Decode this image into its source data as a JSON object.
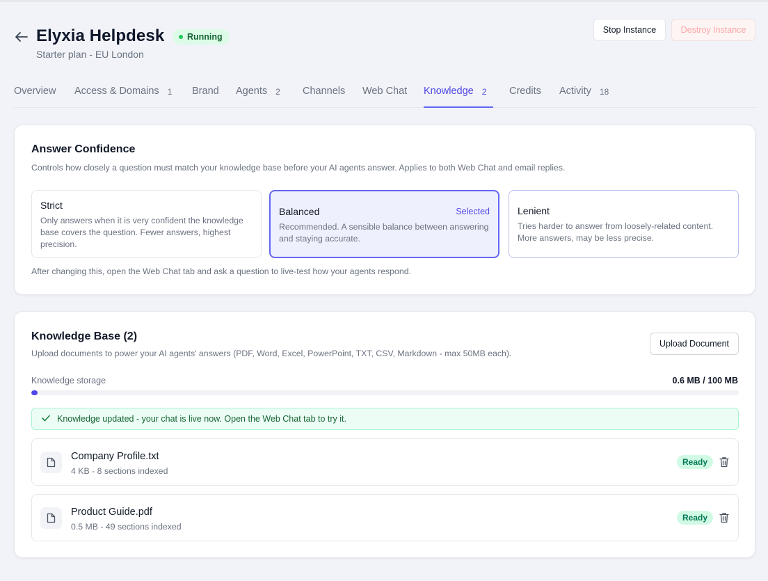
{
  "header": {
    "title": "Elyxia Helpdesk",
    "status": "Running",
    "subtitle": "Starter plan - EU London",
    "stop_label": "Stop Instance",
    "destroy_label": "Destroy Instance"
  },
  "tabs": [
    {
      "label": "Overview",
      "count": ""
    },
    {
      "label": "Access & Domains",
      "count": "1"
    },
    {
      "label": "Brand",
      "count": ""
    },
    {
      "label": "Agents",
      "count": "2"
    },
    {
      "label": "Channels",
      "count": ""
    },
    {
      "label": "Web Chat",
      "count": ""
    },
    {
      "label": "Knowledge",
      "count": "2"
    },
    {
      "label": "Credits",
      "count": ""
    },
    {
      "label": "Activity",
      "count": "18"
    }
  ],
  "active_tab": "Knowledge",
  "confidence": {
    "title": "Answer Confidence",
    "description": "Controls how closely a question must match your knowledge base before your AI agents answer. Applies to both Web Chat and email replies.",
    "options": [
      {
        "name": "Strict",
        "text": "Only answers when it is very confident the knowledge base covers the question. Fewer answers, highest precision."
      },
      {
        "name": "Balanced",
        "text": "Recommended. A sensible balance between answering and staying accurate.",
        "selected_label": "Selected"
      },
      {
        "name": "Lenient",
        "text": "Tries harder to answer from loosely-related content. More answers, may be less precise."
      }
    ],
    "note": "After changing this, open the Web Chat tab and ask a question to live-test how your agents respond."
  },
  "knowledge": {
    "title": "Knowledge Base (2)",
    "description": "Upload documents to power your AI agents' answers (PDF, Word, Excel, PowerPoint, TXT, CSV, Markdown - max 50MB each).",
    "upload_label": "Upload Document",
    "storage_label": "Knowledge storage",
    "storage_value": "0.6 MB / 100 MB",
    "storage_fraction": 0.006,
    "alert": "Knowledge updated - your chat is live now. Open the Web Chat tab to try it.",
    "documents": [
      {
        "name": "Company Profile.txt",
        "meta": "4 KB - 8 sections indexed",
        "status": "Ready"
      },
      {
        "name": "Product Guide.pdf",
        "meta": "0.5 MB - 49 sections indexed",
        "status": "Ready"
      }
    ]
  },
  "colors": {
    "accent": "#4f46e5",
    "running": "#22c55e",
    "ready_bg": "#d1fae5",
    "ready_text": "#047857",
    "destroy_text": "#fca5a5"
  }
}
